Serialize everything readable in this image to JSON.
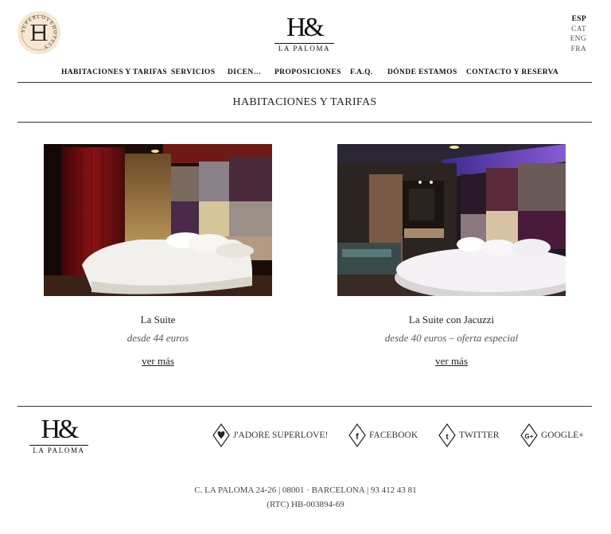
{
  "brand": {
    "seal_text": "SUPERLOVEHOTELS",
    "logo_mark": "H&",
    "logo_sub": "LA PALOMA"
  },
  "languages": [
    {
      "code": "ESP",
      "active": true
    },
    {
      "code": "CAT",
      "active": false
    },
    {
      "code": "ENG",
      "active": false
    },
    {
      "code": "FRA",
      "active": false
    }
  ],
  "nav": [
    "HABITACIONES Y TARIFAS",
    "SERVICIOS",
    "DICEN…",
    "PROPOSICIONES",
    "F.A.Q.",
    "DÓNDE ESTAMOS",
    "CONTACTO Y RESERVA"
  ],
  "page_title": "HABITACIONES Y TARIFAS",
  "rooms": [
    {
      "name": "La Suite",
      "price": "desde 44 euros",
      "link": "ver más"
    },
    {
      "name": "La Suite con Jacuzzi",
      "price": "desde 40 euros – oferta especial",
      "link": "ver más"
    }
  ],
  "footer": {
    "social": [
      {
        "label": "J'ADORE SUPERLOVE!",
        "icon": "heart-icon"
      },
      {
        "label": "FACEBOOK",
        "icon": "facebook-icon"
      },
      {
        "label": "TWITTER",
        "icon": "twitter-icon"
      },
      {
        "label": "GOOGLE+",
        "icon": "google-plus-icon"
      }
    ],
    "address": "C. LA PALOMA 24-26 | 08001 · BARCELONA | 93 412 43 81",
    "license": "(RTC) HB-003894-69"
  }
}
